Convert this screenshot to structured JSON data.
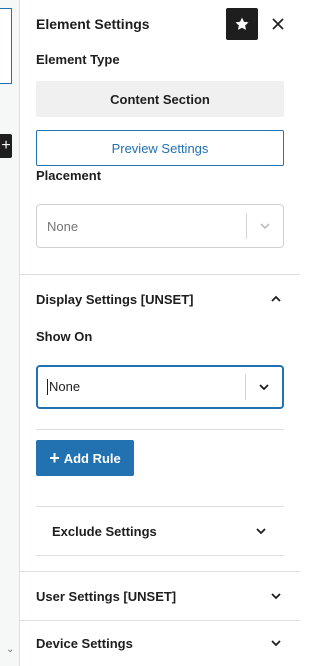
{
  "panel": {
    "title": "Element Settings"
  },
  "element_type": {
    "label": "Element Type",
    "value": "Content Section",
    "preview_button": "Preview Settings"
  },
  "placement": {
    "label": "Placement",
    "value": "None"
  },
  "display_settings": {
    "title": "Display Settings [UNSET]",
    "show_on_label": "Show On",
    "show_on_value": "None",
    "add_rule_label": "Add Rule",
    "exclude_settings_title": "Exclude Settings"
  },
  "user_settings": {
    "title": "User Settings [UNSET]"
  },
  "device_settings": {
    "title": "Device Settings"
  },
  "icons": {
    "star": "star-icon",
    "close": "close-icon",
    "chevron_up": "chevron-up-icon",
    "chevron_down": "chevron-down-icon",
    "plus": "plus-icon"
  },
  "colors": {
    "accent": "#2271b1",
    "dark": "#1e1e1e",
    "muted_bg": "#f0f0f0",
    "border": "#e0e0e0"
  }
}
